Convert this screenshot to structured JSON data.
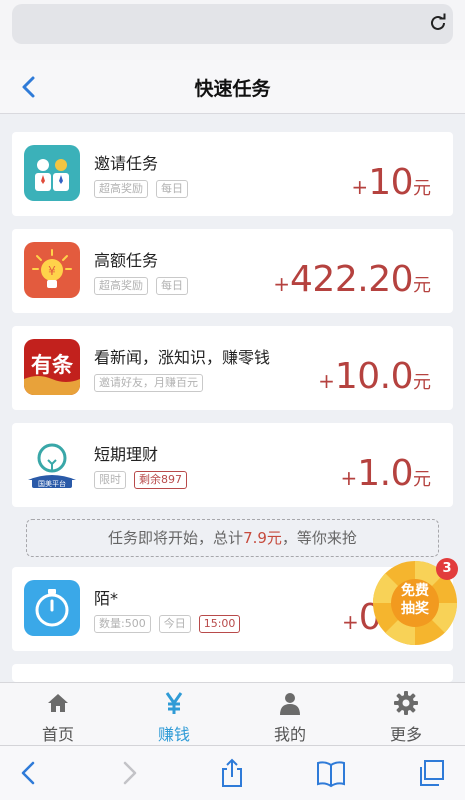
{
  "browser": {
    "reload_icon": "reload-icon"
  },
  "nav": {
    "title": "快速任务",
    "back_icon": "back-chevron-icon"
  },
  "tasks": [
    {
      "title": "邀请任务",
      "tags": [
        "超高奖励",
        "每日"
      ],
      "plus": "+",
      "amount": "10",
      "unit": "元",
      "icon": "invite-users-icon"
    },
    {
      "title": "高额任务",
      "tags": [
        "超高奖励",
        "每日"
      ],
      "plus": "+",
      "amount": "422.20",
      "unit": "元",
      "icon": "lightbulb-money-icon"
    },
    {
      "title": "看新闻，涨知识，赚零钱",
      "tags": [
        "邀请好友，月赚百元"
      ],
      "plus": "+",
      "amount": "10.0",
      "unit": "元",
      "icon": "youtiao-news-logo",
      "logo_text": "有条"
    },
    {
      "title": "短期理财",
      "tags": [
        "限时",
        "剩余897"
      ],
      "plus": "+",
      "amount": "1.0",
      "unit": "元",
      "icon": "finance-bulb-icon",
      "logo_text": "国美平台"
    },
    {
      "title": "陌*",
      "tags": [
        "数量:500",
        "今日",
        "15:00"
      ],
      "plus": "+",
      "amount": "0.",
      "unit": "",
      "icon": "stopwatch-icon"
    }
  ],
  "upcoming": {
    "prefix": "任务即将开始，总计",
    "amount": "7.9元",
    "suffix": "，等你来抢"
  },
  "lottery": {
    "line1": "免费",
    "line2": "抽奖",
    "badge": "3"
  },
  "tabbar": {
    "items": [
      {
        "label": "首页",
        "icon": "home-icon"
      },
      {
        "label": "赚钱",
        "icon": "yen-icon"
      },
      {
        "label": "我的",
        "icon": "user-icon"
      },
      {
        "label": "更多",
        "icon": "gear-icon"
      }
    ],
    "active_color": "#2f9bd6"
  },
  "toolbar": {
    "icons": [
      "back-icon",
      "forward-icon",
      "share-icon",
      "bookmarks-icon",
      "tabs-icon"
    ]
  },
  "colors": {
    "reward": "#b5423f",
    "accent": "#2f9bd6"
  }
}
